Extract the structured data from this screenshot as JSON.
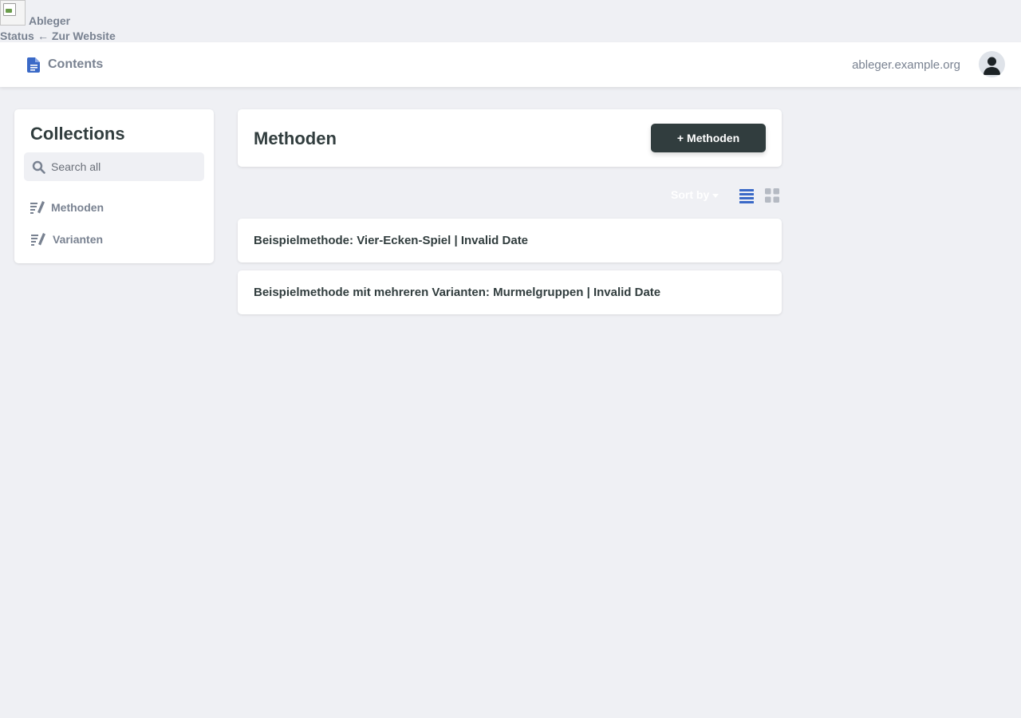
{
  "topbar": {
    "site_name": "Ableger",
    "status_link": "Status",
    "back_link": "← Zur Website"
  },
  "appbar": {
    "contents_label": "Contents",
    "site_url": "ableger.example.org",
    "icons": {
      "contents": "document-icon",
      "account": "user-avatar-icon"
    }
  },
  "sidebar": {
    "title": "Collections",
    "search_placeholder": "Search all",
    "items": [
      {
        "label": "Methoden",
        "icon": "edit-list-icon"
      },
      {
        "label": "Varianten",
        "icon": "edit-list-icon"
      }
    ]
  },
  "main": {
    "title": "Methoden",
    "new_button": "Methoden",
    "new_button_prefix": "+",
    "sort_label": "Sort by",
    "view": {
      "active": "list",
      "options": [
        "list",
        "grid"
      ]
    },
    "entries": [
      "Beispielmethode: Vier-Ecken-Spiel | Invalid Date",
      "Beispielmethode mit mehreren Varianten: Murmelgruppen | Invalid Date"
    ]
  },
  "colors": {
    "background": "#eff0f4",
    "text": "#313d3e",
    "muted": "#798291",
    "accent": "#3a69c7",
    "button": "#313d3e"
  }
}
